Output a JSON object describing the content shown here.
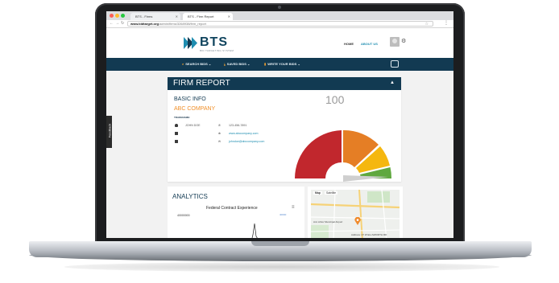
{
  "browser": {
    "tabs": [
      {
        "label": "BTS - Firms"
      },
      {
        "label": "BTS - Firm Report"
      }
    ],
    "url_domain": "www.bidtarget.org",
    "url_path": "/admin/firms/3268938/firm_report"
  },
  "header": {
    "logo_text": "BTS",
    "logo_tagline": "BID TARGETING SYSTEM",
    "links": {
      "home": "HOME",
      "about": "ABOUT US"
    }
  },
  "nav": {
    "items": [
      {
        "label": "SEARCH BIDS",
        "icon": "search-icon"
      },
      {
        "label": "SAVED BIDS",
        "icon": "download-icon"
      },
      {
        "label": "WRITE YOUR BIDS",
        "icon": "document-icon"
      }
    ]
  },
  "report": {
    "title": "FIRM REPORT",
    "section": "BASIC INFO",
    "company": "ABC COMPANY",
    "tradename_label": "TRADENAME:",
    "contact_name": "JOHN DOE",
    "phone": "123-456-7891",
    "website": "www.abccompany.com",
    "email": "johndoe@abccompany.com",
    "score": "100"
  },
  "analytics": {
    "title": "ANALYTICS",
    "chart_title": "Federal Contract Experience",
    "y_tick": "40000000",
    "legend": "40000"
  },
  "map": {
    "tabs": {
      "map": "Map",
      "satellite": "Satellite"
    },
    "labels": {
      "place1": "Ann Arbor Municipal Airport",
      "address": "Address: 47 W ELLSWORTH RD"
    }
  },
  "sidebar": {
    "feedback": "Feedback"
  },
  "colors": {
    "navy": "#123a52",
    "accent_orange": "#f0902a",
    "link_blue": "#1e8db0",
    "gauge_red": "#c1272d",
    "gauge_orange": "#e57e25",
    "gauge_yellow": "#f5b70f",
    "gauge_green": "#5fa83e"
  }
}
